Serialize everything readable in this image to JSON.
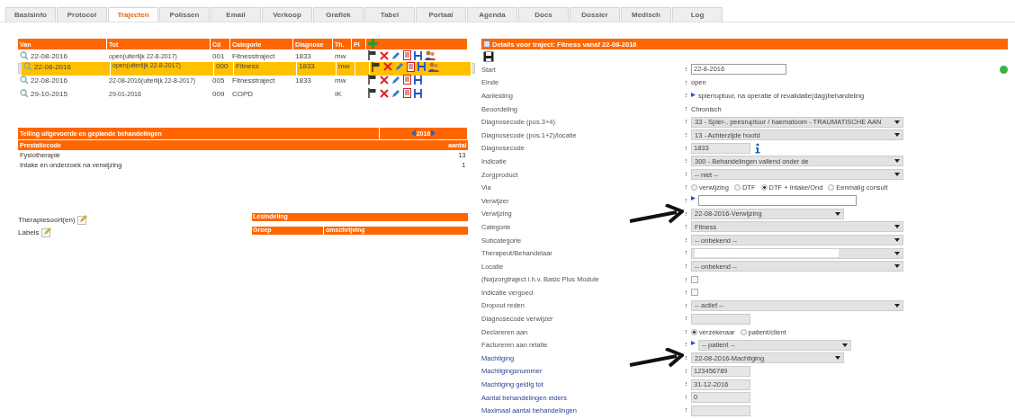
{
  "tabs": [
    {
      "label": "Basisinfo",
      "selected": false
    },
    {
      "label": "Protocol",
      "selected": false
    },
    {
      "label": "Trajecten",
      "selected": true
    },
    {
      "label": "Polissen",
      "selected": false
    },
    {
      "label": "Email",
      "selected": false
    },
    {
      "label": "Verkoop",
      "selected": false
    },
    {
      "label": "Grafiek",
      "selected": false
    },
    {
      "label": "Tabel",
      "selected": false
    },
    {
      "label": "Portaal",
      "selected": false
    },
    {
      "label": "Agenda",
      "selected": false
    },
    {
      "label": "Docs",
      "selected": false
    },
    {
      "label": "Dossier",
      "selected": false
    },
    {
      "label": "Medisch",
      "selected": false
    },
    {
      "label": "Log",
      "selected": false
    }
  ],
  "trajects": {
    "columns": [
      "Van",
      "Tot",
      "Cd",
      "Categorie",
      "Diagnose",
      "Th.",
      "Pl"
    ],
    "rows": [
      {
        "cells": [
          "22-08-2016",
          "open(uiterlijk 22-8-2017)",
          "001",
          "Fitnesstraject",
          "1833",
          "mw",
          ""
        ],
        "selected": false,
        "group_icon": true
      },
      {
        "cells": [
          "22-08-2016",
          "open(uiterlijk 22-8-2017)",
          "000",
          "Fitness",
          "1833",
          "mw",
          ""
        ],
        "selected": true,
        "group_icon": true
      },
      {
        "cells": [
          "22-08-2016",
          "22-08-2016(uiterlijk 22-8-2017)",
          "005",
          "Fitnesstraject",
          "1833",
          "mw",
          ""
        ],
        "selected": false,
        "group_icon": false
      },
      {
        "cells": [
          "29-10-2015",
          "29-01-2016",
          "009",
          "COPD",
          "",
          "IK",
          ""
        ],
        "selected": false,
        "group_icon": false
      }
    ]
  },
  "counts": {
    "title": "Telling uitgevoerde en geplande behandelingen",
    "year": "2016",
    "columns": [
      "Prestatiecode",
      "aantal"
    ],
    "rows": [
      {
        "name": "Fysiotherapie",
        "count": "13"
      },
      {
        "name": "Intake en onderzoek na verwijzing",
        "count": "1"
      }
    ]
  },
  "labels": [
    "Therapiesoort(en)",
    "Labels"
  ],
  "groups": {
    "title": "Lesindeling",
    "columns": [
      "Groep",
      "omschrijving"
    ]
  },
  "details": {
    "title": "Details voor traject: Fitness vanaf 22-08-2016",
    "rows": [
      {
        "kind": "input",
        "label": "Start",
        "value": "22-8-2016",
        "highlighted": false,
        "side_icon": true
      },
      {
        "kind": "text",
        "label": "Einde",
        "value": "open",
        "highlighted": false
      },
      {
        "kind": "flagtext",
        "label": "Aanleiding",
        "value": "spierruptuur, na operatie of revalidatie(dag)behandeling",
        "highlighted": false
      },
      {
        "kind": "text",
        "label": "Beoordeling",
        "value": "Chronisch",
        "highlighted": false
      },
      {
        "kind": "select",
        "label": "Diagnosecode (pos.3+4)",
        "value": "33 - Spier-, peesruptuur / haematoom - TRAUMATISCHE AAN",
        "highlighted": false
      },
      {
        "kind": "select",
        "label": "Diagnosecode (pos.1+2)/locatie",
        "value": "13 - Achterzijde hoofd",
        "highlighted": false
      },
      {
        "kind": "readonly",
        "label": "Diagnosecode",
        "value": "1833",
        "highlighted": false,
        "info": true
      },
      {
        "kind": "select",
        "label": "Indicatie",
        "value": "300 - Behandelingen vallend onder de",
        "highlighted": false
      },
      {
        "kind": "select",
        "label": "Zorgproduct",
        "value": "-- niet --",
        "highlighted": false
      },
      {
        "kind": "radio",
        "label": "Via",
        "highlighted": false,
        "options": [
          {
            "label": "verwijzing",
            "selected": false
          },
          {
            "label": "DTF",
            "selected": false
          },
          {
            "label": "DTF + Intake/Ond",
            "selected": true
          },
          {
            "label": "Eenmalig consult",
            "selected": false
          }
        ]
      },
      {
        "kind": "flaginput",
        "label": "Verwijzer",
        "highlighted": false
      },
      {
        "kind": "shortselect",
        "label": "Verwijzing",
        "value": "22-08-2016-Verwijzing",
        "highlighted": false,
        "arrow": true
      },
      {
        "kind": "select",
        "label": "Categorie",
        "value": "Fitness",
        "highlighted": false
      },
      {
        "kind": "select",
        "label": "Subcategorie",
        "value": "-- onbekend --",
        "highlighted": false
      },
      {
        "kind": "select",
        "label": "Therapeut/Behandelaar",
        "highlighted": false
      },
      {
        "kind": "select",
        "label": "Locatie",
        "value": "-- onbekend --",
        "highlighted": false
      },
      {
        "kind": "checkbox",
        "label": "(Na)zorgtraject i.h.v. Basic Plus Module",
        "checked": false,
        "highlighted": false
      },
      {
        "kind": "checkbox",
        "label": "Indicatie vergoed",
        "checked": false,
        "highlighted": false
      },
      {
        "kind": "select",
        "label": "Dropout reden",
        "value": "-- actief --",
        "highlighted": false
      },
      {
        "kind": "readonly",
        "label": "Diagnosecode verwijzer",
        "highlighted": false
      },
      {
        "kind": "radio",
        "label": "Declareren aan",
        "highlighted": false,
        "options": [
          {
            "label": "verzekeraar",
            "selected": true
          },
          {
            "label": "patient/client",
            "selected": false
          }
        ]
      },
      {
        "kind": "flagselect",
        "label": "Factureren aan relatie",
        "value": "-- patient --",
        "highlighted": false
      },
      {
        "kind": "shortselect",
        "label": "Machtiging",
        "value": "22-08-2016-Machtiging",
        "highlighted": true,
        "arrow": true
      },
      {
        "kind": "readonly",
        "label": "Machtigingsnummer",
        "value": "123456789",
        "highlighted": true
      },
      {
        "kind": "readonly",
        "label": "Machtiging geldig tot",
        "value": "31-12-2016",
        "highlighted": true
      },
      {
        "kind": "readonly",
        "label": "Aantal behandelingen elders",
        "value": "0",
        "highlighted": true
      },
      {
        "kind": "readonly",
        "label": "Maximaal aantal behandelingen",
        "highlighted": true
      }
    ]
  }
}
